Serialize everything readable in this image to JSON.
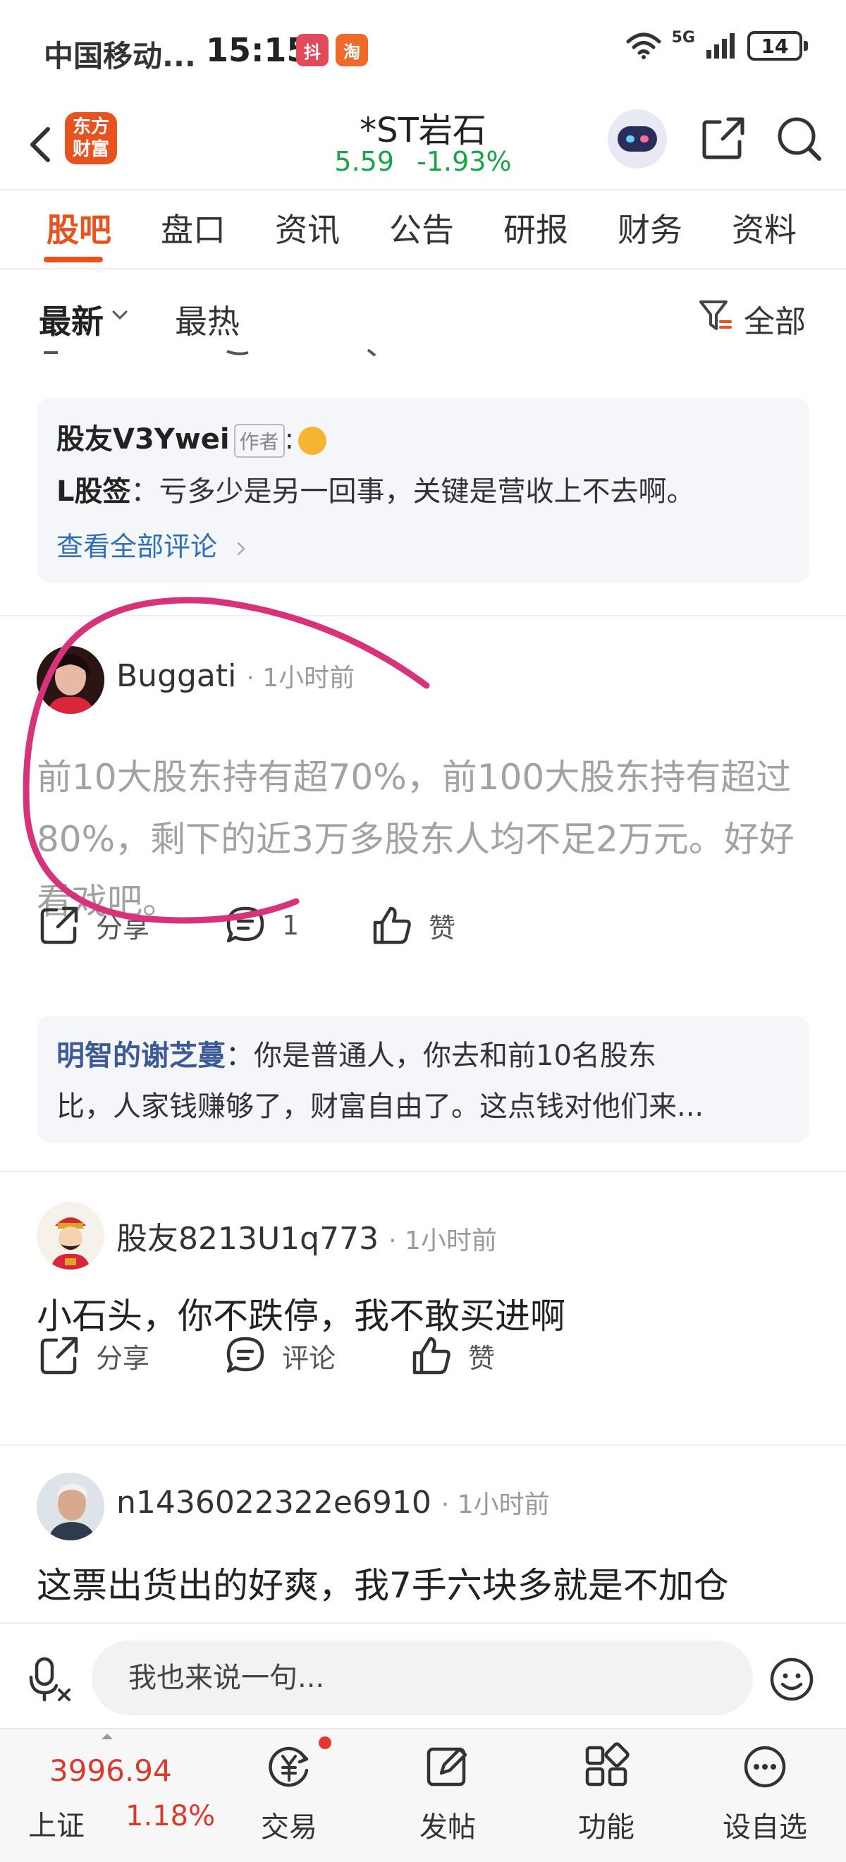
{
  "status_bar": {
    "carrier": "中国移动...",
    "time": "15:15",
    "app_icon_1": "抖",
    "app_icon_2": "淘",
    "network": "5G",
    "battery": "14"
  },
  "header": {
    "logo_line1": "东方",
    "logo_line2": "财富",
    "stock_name": "*ST岩石",
    "price": "5.59",
    "change_pct": "-1.93%",
    "quote_color": "#1aa34a"
  },
  "tabs": [
    "股吧",
    "盘口",
    "资讯",
    "公告",
    "研报",
    "财务",
    "资料"
  ],
  "sort": {
    "latest": "最新",
    "hot": "最热",
    "filter": "全部"
  },
  "feed": {
    "reply_block_1": {
      "author": "股友V3Ywei",
      "author_tag": "作者",
      "colon": ":",
      "replier": "L股签",
      "text": "：亏多少是另一回事，关键是营收上不去啊。",
      "view_all": "查看全部评论"
    },
    "posts": [
      {
        "user": "Buggati",
        "time": "· 1小时前",
        "text": "前10大股东持有超70%，前100大股东持有超过80%，剩下的近3万多股东人均不足2万元。好好看戏吧。",
        "share": "分享",
        "comments": "1",
        "like": "赞",
        "reply_name": "明智的谢芝蔓",
        "reply_line1": "：你是普通人，你去和前10名股东",
        "reply_line2": "比，人家钱赚够了，财富自由了。这点钱对他们来..."
      },
      {
        "user": "股友8213U1q773",
        "time": "· 1小时前",
        "text": "小石头，你不跌停，我不敢买进啊",
        "share": "分享",
        "comments": "评论",
        "like": "赞"
      },
      {
        "user": "n1436022322e6910",
        "time": "· 1小时前",
        "text": "这票出货出的好爽，我7手六块多就是不加仓"
      }
    ]
  },
  "input_bar": {
    "placeholder": "我也来说一句..."
  },
  "bottom_nav": {
    "index_value": "3996.94",
    "index_name": "上证",
    "index_change": "1.18%",
    "items": [
      "交易",
      "发帖",
      "功能",
      "设自选"
    ]
  },
  "colors": {
    "accent": "#e8521f",
    "annotation": "#d6337a",
    "up_red": "#d83a2e",
    "link_blue": "#2f6fb5"
  }
}
